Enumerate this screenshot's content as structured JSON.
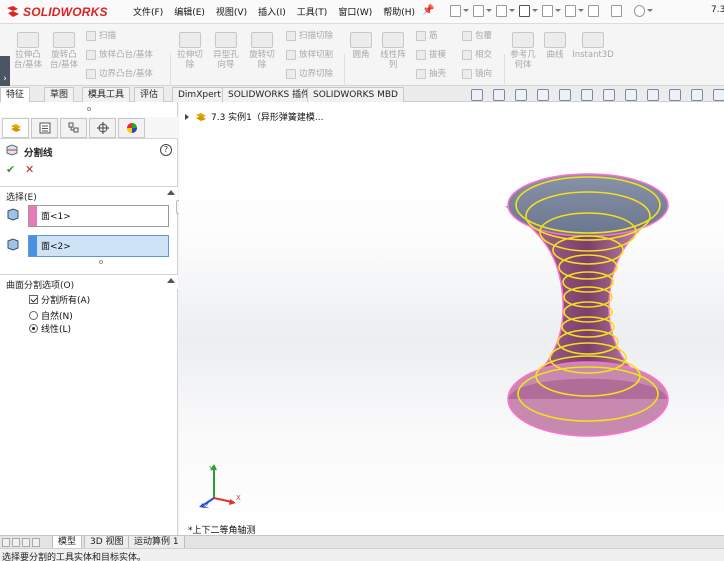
{
  "app": {
    "brand": "SOLIDWORKS",
    "version": "7.3"
  },
  "menu": [
    "文件(F)",
    "编辑(E)",
    "视图(V)",
    "插入(I)",
    "工具(T)",
    "窗口(W)",
    "帮助(H)"
  ],
  "ribbon": {
    "extrude_boss": "拉伸凸\n台/基体",
    "revolve_boss": "旋转凸\n台/基体",
    "sweep": "扫描",
    "loft_boss": "放样凸台/基体",
    "boundary_boss": "边界凸台/基体",
    "extrude_cut": "拉伸切\n除",
    "hole_wizard": "异型孔\n向导",
    "revolve_cut": "旋转切\n除",
    "swept_cut": "扫描切除",
    "lofted_cut": "放样切割",
    "boundary_cut": "边界切除",
    "fillet": "圆角",
    "linear_pattern": "线性阵\n列",
    "rib": "筋",
    "draft": "拔模",
    "shell": "抽壳",
    "wrap": "包覆",
    "intersect": "相交",
    "mirror": "镜向",
    "ref_geometry": "参考几\n何体",
    "curves": "曲线",
    "instant3d": "Instant3D"
  },
  "tabs": [
    "特征",
    "草图",
    "模具工具",
    "评估",
    "DimXpert",
    "SOLIDWORKS 插件",
    "SOLIDWORKS MBD"
  ],
  "property_manager": {
    "title": "分割线",
    "help": "?",
    "ok": "✔",
    "cancel": "✕",
    "selection_header": "选择(E)",
    "face1": "面<1>",
    "face2": "面<2>",
    "options_header": "曲面分割选项(O)",
    "split_all": "分割所有(A)",
    "natural": "自然(N)",
    "linear": "线性(L)"
  },
  "viewport": {
    "tree_label": "7.3 实例1（异形弹簧建模...",
    "view_orientation": "*上下二等角轴测"
  },
  "bottom_tabs": [
    "模型",
    "3D 视图",
    "运动算例 1"
  ],
  "status": "选择要分割的工具实体和目标实体。",
  "colors": {
    "face1_flag": "#e879b9",
    "face2_flag": "#4a90e2",
    "spring": "#f2e11d",
    "body": "#9c5a8a",
    "edge": "#ff6fd0"
  }
}
